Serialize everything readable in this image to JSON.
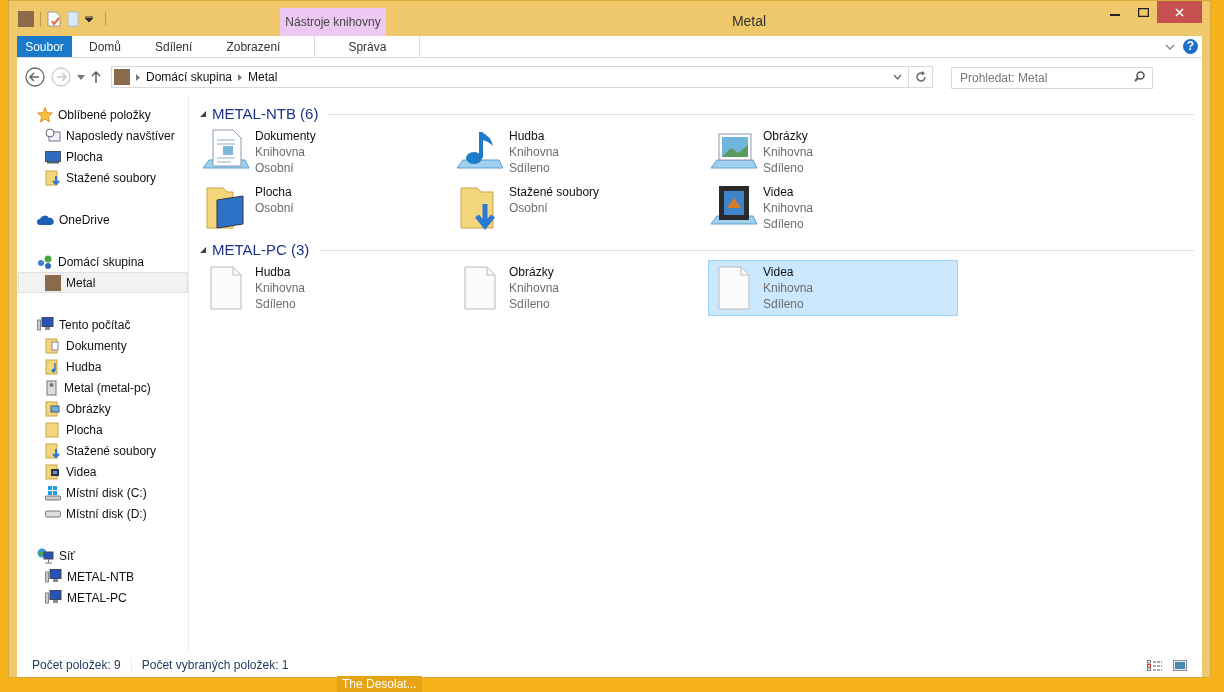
{
  "window": {
    "title": "Metal"
  },
  "contextual_header": "Nástroje knihovny",
  "ribbon_tabs": [
    {
      "label": "Soubor",
      "kind": "file"
    },
    {
      "label": "Domů",
      "kind": "tab"
    },
    {
      "label": "Sdílení",
      "kind": "tab"
    },
    {
      "label": "Zobrazení",
      "kind": "tab"
    },
    {
      "label": "Správa",
      "kind": "contextual"
    }
  ],
  "help_button": "?",
  "address_bar": {
    "path": [
      "Domácí skupina",
      "Metal"
    ]
  },
  "search": {
    "placeholder": "Prohledat: Metal"
  },
  "sidebar": {
    "sections": [
      {
        "label": "Oblíbené položky",
        "selected": false,
        "children": [
          {
            "label": "Naposledy navštíver",
            "selected": false
          },
          {
            "label": "Plocha",
            "selected": false
          },
          {
            "label": "Stažené soubory",
            "selected": false
          }
        ]
      },
      {
        "label": "OneDrive",
        "selected": false
      },
      {
        "label": "Domácí skupina",
        "selected": false,
        "children": [
          {
            "label": "Metal",
            "selected": true
          }
        ]
      },
      {
        "label": "Tento počítač",
        "selected": false,
        "children": [
          {
            "label": "Dokumenty",
            "selected": false
          },
          {
            "label": "Hudba",
            "selected": false
          },
          {
            "label": "Metal (metal-pc)",
            "selected": false
          },
          {
            "label": "Obrázky",
            "selected": false
          },
          {
            "label": "Plocha",
            "selected": false
          },
          {
            "label": "Stažené soubory",
            "selected": false
          },
          {
            "label": "Videa",
            "selected": false
          },
          {
            "label": "Místní disk (C:)",
            "selected": false
          },
          {
            "label": "Místní disk (D:)",
            "selected": false
          }
        ]
      },
      {
        "label": "Síť",
        "selected": false,
        "children": [
          {
            "label": "METAL-NTB",
            "selected": false
          },
          {
            "label": "METAL-PC",
            "selected": false
          }
        ]
      }
    ]
  },
  "groups": [
    {
      "title": "METAL-NTB (6)",
      "items": [
        {
          "name": "Dokumenty",
          "lines": [
            "Knihovna",
            "Osobní"
          ],
          "selected": false
        },
        {
          "name": "Hudba",
          "lines": [
            "Knihovna",
            "Sdíleno"
          ],
          "selected": false
        },
        {
          "name": "Obrázky",
          "lines": [
            "Knihovna",
            "Sdíleno"
          ],
          "selected": false
        },
        {
          "name": "Plocha",
          "lines": [
            "Osobní"
          ],
          "selected": false
        },
        {
          "name": "Stažené soubory",
          "lines": [
            "Osobní"
          ],
          "selected": false
        },
        {
          "name": "Videa",
          "lines": [
            "Knihovna",
            "Sdíleno"
          ],
          "selected": false
        }
      ]
    },
    {
      "title": "METAL-PC (3)",
      "items": [
        {
          "name": "Hudba",
          "lines": [
            "Knihovna",
            "Sdíleno"
          ],
          "selected": false
        },
        {
          "name": "Obrázky",
          "lines": [
            "Knihovna",
            "Sdíleno"
          ],
          "selected": false
        },
        {
          "name": "Videa",
          "lines": [
            "Knihovna",
            "Sdíleno"
          ],
          "selected": true
        }
      ]
    }
  ],
  "status_bar": {
    "items": [
      "Počet položek: 9",
      "Počet vybraných položek: 1"
    ]
  },
  "taskbar_label": "The Desolat..."
}
